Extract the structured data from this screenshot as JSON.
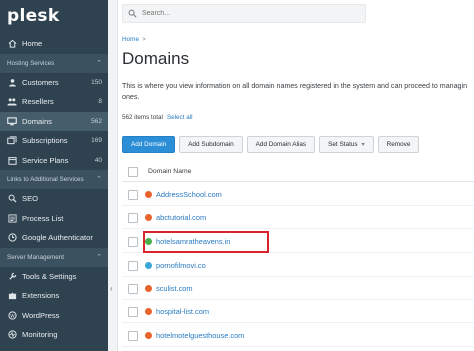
{
  "app": {
    "logo": "plesk"
  },
  "sidebar": {
    "items": [
      {
        "type": "item",
        "label": "Home",
        "icon": "home-icon"
      },
      {
        "type": "section",
        "label": "Hosting Services"
      },
      {
        "type": "item",
        "label": "Customers",
        "count": "150",
        "icon": "user-icon"
      },
      {
        "type": "item",
        "label": "Resellers",
        "count": "8",
        "icon": "users-icon"
      },
      {
        "type": "item",
        "label": "Domains",
        "count": "562",
        "icon": "monitor-icon",
        "active": true
      },
      {
        "type": "item",
        "label": "Subscriptions",
        "count": "169",
        "icon": "cards-icon"
      },
      {
        "type": "item",
        "label": "Service Plans",
        "count": "40",
        "icon": "calendar-icon"
      },
      {
        "type": "section",
        "label": "Links to Additional Services"
      },
      {
        "type": "item",
        "label": "SEO",
        "icon": "seo-icon"
      },
      {
        "type": "item",
        "label": "Process List",
        "icon": "list-icon"
      },
      {
        "type": "item",
        "label": "Google Authenticator",
        "icon": "authenticator-icon"
      },
      {
        "type": "section",
        "label": "Server Management"
      },
      {
        "type": "item",
        "label": "Tools & Settings",
        "icon": "wrench-icon"
      },
      {
        "type": "item",
        "label": "Extensions",
        "icon": "puzzle-icon"
      },
      {
        "type": "item",
        "label": "WordPress",
        "icon": "wordpress-icon"
      },
      {
        "type": "item",
        "label": "Monitoring",
        "icon": "pulse-icon"
      }
    ]
  },
  "search": {
    "placeholder": "Search..."
  },
  "breadcrumb": {
    "home": "Home",
    "separator": ">"
  },
  "page": {
    "title": "Domains",
    "description_line1": "This is where you view information on all domain names registered in the system and can proceed to managin",
    "description_line2": "ones.",
    "items_total": "562 items total",
    "select_all": "Select all"
  },
  "toolbar": {
    "add_domain": "Add Domain",
    "add_subdomain": "Add Subdomain",
    "add_alias": "Add Domain Alias",
    "set_status": "Set Status",
    "remove": "Remove"
  },
  "table": {
    "column_header": "Domain Name",
    "rows": [
      {
        "name": "AddressSchool.com",
        "fav_color": "#e8622c"
      },
      {
        "name": "abctutorial.com",
        "fav_color": "#e8622c"
      },
      {
        "name": "hotelsamratheavens.in",
        "fav_color": "#4cae4c",
        "highlighted": true
      },
      {
        "name": "pornofilmovi.co",
        "fav_color": "#3aa7d8"
      },
      {
        "name": "sculist.com",
        "fav_color": "#e8622c"
      },
      {
        "name": "hospital-list.com",
        "fav_color": "#e8622c"
      },
      {
        "name": "hotelmotelguesthouse.com",
        "fav_color": "#e8622c"
      }
    ]
  },
  "colors": {
    "accent": "#2b8ed6",
    "sidebar": "#2f4250",
    "highlight": "#d9222a"
  }
}
